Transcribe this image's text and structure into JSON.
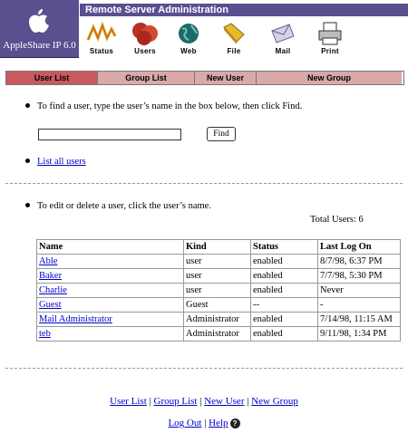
{
  "header": {
    "product": "AppleShare IP 6.0",
    "title": "Remote Server Administration",
    "tools": [
      {
        "label": "Status",
        "icon": "status-icon"
      },
      {
        "label": "Users",
        "icon": "users-icon"
      },
      {
        "label": "Web",
        "icon": "web-icon"
      },
      {
        "label": "File",
        "icon": "file-icon"
      },
      {
        "label": "Mail",
        "icon": "mail-icon"
      },
      {
        "label": "Print",
        "icon": "print-icon"
      }
    ]
  },
  "tabs": [
    {
      "label": "User List",
      "active": true
    },
    {
      "label": "Group List",
      "active": false
    },
    {
      "label": "New User",
      "active": false
    },
    {
      "label": "New Group",
      "active": false
    }
  ],
  "find": {
    "instruction": "To find a user, type the user’s name in the box below, then click Find.",
    "input_value": "",
    "button_label": "Find",
    "list_all_link": "List all users"
  },
  "edit": {
    "instruction": "To edit or delete a user, click the user’s name.",
    "total_users": "Total Users: 6"
  },
  "table": {
    "columns": [
      "Name",
      "Kind",
      "Status",
      "Last Log On"
    ],
    "rows": [
      [
        "Able",
        "user",
        "enabled",
        "8/7/98, 6:37 PM"
      ],
      [
        "Baker",
        "user",
        "enabled",
        "7/7/98, 5:30 PM"
      ],
      [
        "Charlie",
        "user",
        "enabled",
        "Never"
      ],
      [
        "Guest",
        "Guest",
        "--",
        "-"
      ],
      [
        "Mail Administrator",
        "Administrator",
        "enabled",
        "7/14/98, 11:15 AM"
      ],
      [
        "teb",
        "Administrator",
        "enabled",
        "9/11/98, 1:34 PM"
      ]
    ]
  },
  "footer": {
    "user_list": "User List",
    "group_list": "Group List",
    "new_user": "New User",
    "new_group": "New Group",
    "separator": " | ",
    "log_out": "Log Out",
    "help": "Help",
    "help_icon_glyph": "?"
  },
  "colors": {
    "header_purple": "#5a4f8f",
    "tab_active": "#c85a5e",
    "tab_inactive": "#d9a9aa",
    "link": "#0000cc"
  }
}
